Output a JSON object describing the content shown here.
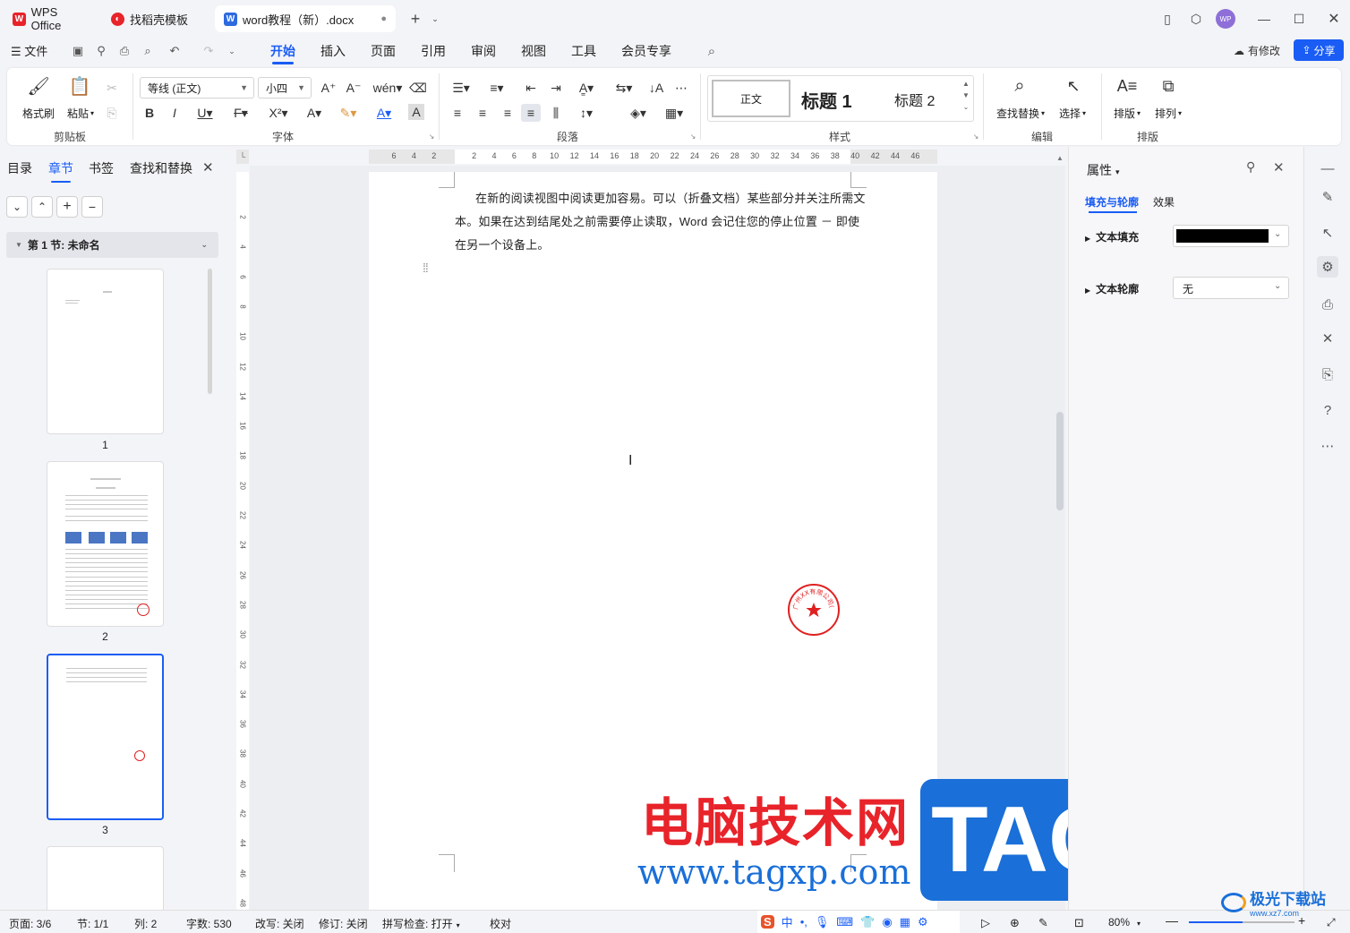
{
  "titlebar": {
    "tabs": [
      {
        "label": "WPS Office",
        "icon": "wps-logo-icon"
      },
      {
        "label": "找稻壳模板",
        "icon": "docer-icon"
      },
      {
        "label": "word教程（新）.docx",
        "icon": "word-doc-icon"
      }
    ],
    "avatar_text": "WP"
  },
  "menubar": {
    "file_label": "文件",
    "tabs": [
      "开始",
      "插入",
      "页面",
      "引用",
      "审阅",
      "视图",
      "工具",
      "会员专享"
    ],
    "active_tab": "开始",
    "modified_label": "有修改",
    "share_label": "分享"
  },
  "ribbon": {
    "clipboard": {
      "format_painter": "格式刷",
      "paste": "粘贴",
      "group": "剪贴板"
    },
    "font": {
      "family": "等线 (正文)",
      "size": "小四",
      "group": "字体"
    },
    "paragraph": {
      "group": "段落"
    },
    "styles": {
      "normal": "正文",
      "heading1": "标题  1",
      "heading2": "标题  2",
      "group": "样式"
    },
    "edit": {
      "find_replace": "查找替换",
      "select": "选择",
      "group": "编辑"
    },
    "layout": {
      "arrange_text": "排版",
      "arrange": "排列",
      "group": "排版"
    }
  },
  "leftpanel": {
    "tabs": [
      "目录",
      "章节",
      "书签",
      "查找和替换"
    ],
    "active_tab": "章节",
    "section_title": "第 1 节: 未命名",
    "pages": [
      "1",
      "2",
      "3"
    ]
  },
  "hruler": [
    "6",
    "4",
    "2",
    "",
    "2",
    "4",
    "6",
    "8",
    "10",
    "12",
    "14",
    "16",
    "18",
    "20",
    "22",
    "24",
    "26",
    "28",
    "30",
    "32",
    "34",
    "36",
    "38",
    "40",
    "42",
    "44",
    "46"
  ],
  "vruler": [
    "2",
    "4",
    "6",
    "8",
    "10",
    "12",
    "14",
    "16",
    "18",
    "20",
    "22",
    "24",
    "26",
    "28",
    "30",
    "32",
    "34",
    "36",
    "38",
    "40",
    "42",
    "44",
    "46",
    "48"
  ],
  "document": {
    "lines": [
      "在新的阅读视图中阅读更加容易。可以（折叠文档）某些部分并关注所需文",
      "本。如果在达到结尾处之前需要停止读取，Word 会记住您的停止位置 － 即使",
      "在另一个设备上。"
    ],
    "stamp_text": "广州XX有限公司(财务公章)"
  },
  "rightpanel": {
    "title": "属性",
    "tabs": [
      "填充与轮廓",
      "效果"
    ],
    "active_tab": "填充与轮廓",
    "text_fill_label": "文本填充",
    "text_fill_color": "#000000",
    "text_outline_label": "文本轮廓",
    "text_outline_value": "无"
  },
  "statusbar": {
    "page": "页面: 3/6",
    "section": "节: 1/1",
    "column": "列: 2",
    "words": "字数: 530",
    "overwrite": "改写: 关闭",
    "revision": "修订: 关闭",
    "spellcheck": "拼写检查: 打开",
    "proofread": "校对",
    "zoom": "80%"
  },
  "watermark": {
    "site_name": "电脑技术网",
    "site_url": "www.tagxp.com",
    "tag": "TAG",
    "corner_text": "极光下载站",
    "corner_url": "www.xz7.com"
  },
  "colors": {
    "accent": "#1a5df5",
    "stamp": "#e02020",
    "watermark_red": "#e8232a",
    "watermark_blue": "#1a6fd8"
  }
}
